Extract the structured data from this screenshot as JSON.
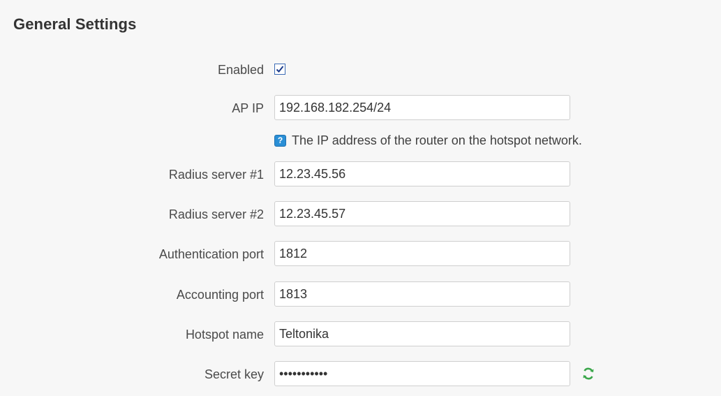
{
  "section": {
    "title": "General Settings"
  },
  "fields": {
    "enabled": {
      "label": "Enabled",
      "checked": true
    },
    "ap_ip": {
      "label": "AP IP",
      "value": "192.168.182.254/24"
    },
    "ap_ip_help": "The IP address of the router on the hotspot network.",
    "radius1": {
      "label": "Radius server #1",
      "value": "12.23.45.56"
    },
    "radius2": {
      "label": "Radius server #2",
      "value": "12.23.45.57"
    },
    "auth_port": {
      "label": "Authentication port",
      "value": "1812"
    },
    "acct_port": {
      "label": "Accounting port",
      "value": "1813"
    },
    "hotspot_name": {
      "label": "Hotspot name",
      "value": "Teltonika"
    },
    "secret_key": {
      "label": "Secret key",
      "value": "***********"
    }
  },
  "icons": {
    "help": "help-icon",
    "refresh": "refresh-icon",
    "check": "checkmark-icon"
  },
  "colors": {
    "background": "#f7f7f7",
    "help_icon": "#2a8fd6",
    "refresh_icon": "#3aa64a",
    "checkbox_border": "#3b6bb5"
  }
}
